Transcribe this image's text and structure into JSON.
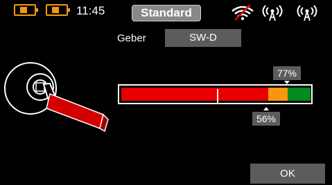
{
  "status_bar": {
    "time": "11:45",
    "battery_1_icon": "battery-icon",
    "battery_2_icon": "battery-icon",
    "wifi_icon": "wifi-icon",
    "antenna_1_icon": "antenna-icon",
    "antenna_2_icon": "antenna-icon",
    "accent_color": "#f29a10"
  },
  "header": {
    "title": "Standard"
  },
  "geber": {
    "label": "Geber",
    "value": "SW-D"
  },
  "stick": {
    "icon": "switch-lever-icon",
    "color": "#d40000"
  },
  "bar": {
    "colors": {
      "red": "#e60000",
      "orange": "#f7960f",
      "green": "#008a1f"
    },
    "marker_top": "77%",
    "marker_bottom": "56%"
  },
  "footer": {
    "ok_label": "OK"
  }
}
